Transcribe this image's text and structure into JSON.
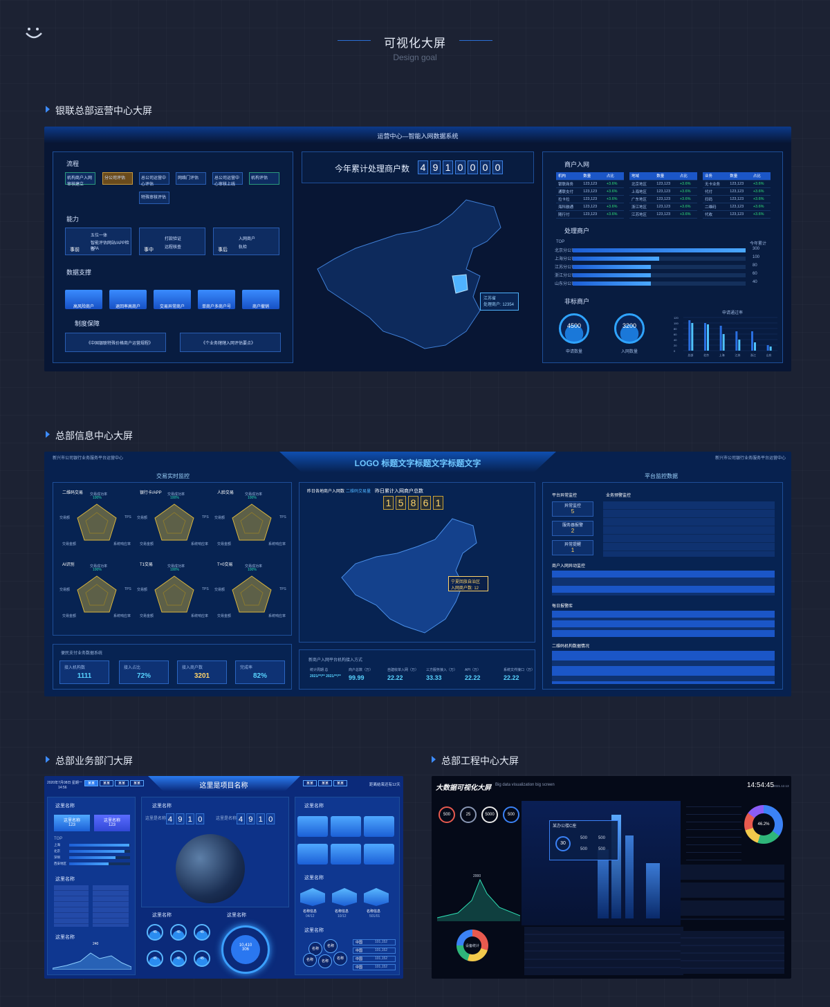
{
  "header": {
    "title": "可视化大屏",
    "subtitle": "Design goal",
    "logo_icon": "smile-icon"
  },
  "sections": [
    {
      "title": "银联总部运营中心大屏"
    },
    {
      "title": "总部信息中心大屏"
    },
    {
      "title": "总部业务部门大屏"
    },
    {
      "title": "总部工程中心大屏"
    }
  ],
  "screen1": {
    "title": "运营中心—智能入网数据系统",
    "flow": {
      "title": "流程",
      "steps": [
        "机构商户入网审核建立",
        "分公司评估",
        "总公司运营中心评估",
        "网络门评估",
        "总公司运营中心审核上线",
        "机构评估",
        "特殊审核评估"
      ]
    },
    "ability": {
      "title": "能力",
      "items": [
        {
          "tag": "事前",
          "lines": [
            "五位一体",
            "智能评估网站/APP检查",
            "RPA"
          ]
        },
        {
          "tag": "事中",
          "lines": [
            "打款验证",
            "远程核查"
          ]
        },
        {
          "tag": "事后",
          "lines": [
            "入网商户",
            "轨检"
          ]
        }
      ]
    },
    "support": {
      "title": "数据支撑",
      "items": [
        "高风险商户",
        "退回率高商户",
        "交易异常商户",
        "单商户多商户号",
        "商户撤销"
      ]
    },
    "policy": {
      "title": "制度保障",
      "items": [
        "《中国银联特殊价格商户运营规程》",
        "《个业务辖辖入网评估要点》"
      ]
    },
    "counter": {
      "label": "今年累计处理商户数",
      "digits": [
        "4",
        "9",
        "1",
        "0",
        "0",
        "0",
        "0"
      ]
    },
    "map_tip": {
      "province": "江苏省",
      "value": "处理商户: 12354"
    },
    "merchant": {
      "title": "商户入网",
      "tables": [
        {
          "head": [
            "机构",
            "数量",
            "占比"
          ],
          "rows": [
            [
              "银联商务",
              "123,123",
              "+3.6%"
            ],
            [
              "通联支付",
              "123,123",
              "+3.6%"
            ],
            [
              "拉卡拉",
              "123,123",
              "+3.6%"
            ],
            [
              "海科融通",
              "123,123",
              "+3.6%"
            ],
            [
              "随行付",
              "123,123",
              "+3.6%"
            ]
          ]
        },
        {
          "head": [
            "地域",
            "数量",
            "占比"
          ],
          "rows": [
            [
              "北京地区",
              "123,123",
              "+3.6%"
            ],
            [
              "上海地区",
              "123,123",
              "+3.6%"
            ],
            [
              "广东地区",
              "123,123",
              "+3.6%"
            ],
            [
              "浙江地区",
              "123,123",
              "+3.6%"
            ],
            [
              "江苏地区",
              "123,123",
              "+3.6%"
            ]
          ]
        },
        {
          "head": [
            "业务",
            "数量",
            "占比"
          ],
          "rows": [
            [
              "无卡业务",
              "123,123",
              "+3.6%"
            ],
            [
              "代付",
              "123,123",
              "+3.6%"
            ],
            [
              "扫码",
              "123,123",
              "+3.6%"
            ],
            [
              "二维码",
              "123,123",
              "+3.6%"
            ],
            [
              "代收",
              "123,123",
              "+3.6%"
            ]
          ]
        }
      ]
    },
    "process": {
      "title": "处理商户",
      "top_label": "TOP",
      "right_label": "今年累计",
      "rows": [
        {
          "name": "北京分公司",
          "value": 300
        },
        {
          "name": "上海分公司",
          "value": 100
        },
        {
          "name": "江苏分公司",
          "value": 80
        },
        {
          "name": "浙江分公司",
          "value": 60
        },
        {
          "name": "山东分公司",
          "value": 40
        }
      ]
    },
    "nonstd": {
      "title": "非标商户",
      "gauges": [
        {
          "value": "4500",
          "label": "申请数量"
        },
        {
          "value": "3200",
          "label": "入网数量"
        }
      ],
      "chart_title": "申请通过率"
    }
  },
  "chart_data": [
    {
      "type": "bar",
      "title": "申请通过率",
      "categories": [
        "总部",
        "北京",
        "上海",
        "江苏",
        "浙江",
        "山东"
      ],
      "series": [
        {
          "values": [
            110,
            100,
            90,
            70,
            70,
            20
          ]
        },
        {
          "values": [
            100,
            95,
            60,
            40,
            30,
            15
          ]
        }
      ],
      "ylim": [
        0,
        120
      ],
      "yticks": [
        0,
        20,
        40,
        60,
        80,
        100,
        120
      ]
    }
  ],
  "screen2": {
    "title": "LOGO 标题文字标题文字标题文字",
    "left_top_note": "新兴市公司银行业务服务平台运营中心",
    "right_top_note": "新兴市公司银行业务服务平台运营中心",
    "left_tab": "交易实时监控",
    "right_tab": "平台监控数据",
    "radar_titles": [
      "二维码交易",
      "银行卡/APP",
      "人脸交易",
      "AI识别",
      "T1交易",
      "T+0交易"
    ],
    "radar_labels": {
      "top": "交易成功率",
      "top_val": "100%",
      "left": "交易额",
      "right": "TPS",
      "bl": "交易金额",
      "br": "系统响应率",
      "val": "60%"
    },
    "map_tabs": [
      "昨日各地商户入网数",
      "二维码交易量"
    ],
    "counter_label": "昨日累计入网商户总数",
    "counter": [
      "1",
      "5",
      "8",
      "6",
      "1"
    ],
    "map_tip": {
      "title": "宁夏回族自治区",
      "value": "入网商户数: 12"
    },
    "bottom_left": {
      "title": "便民支付业务数据系统",
      "cards": [
        {
          "label": "接入机构数",
          "value": "1111"
        },
        {
          "label": "接入占比",
          "value": "72%"
        },
        {
          "label": "接入商户数",
          "value": "3201"
        },
        {
          "label": "完成率",
          "value": "82%"
        }
      ]
    },
    "bottom_mid": {
      "title": "新商户入网平台机构接入方式",
      "cols": [
        {
          "label": "统计周期 总",
          "value": "2021/**/** 2021/**/**"
        },
        {
          "label": "商户总数（万）",
          "value": "99.99"
        },
        {
          "label": "自建收单入网（万）",
          "value": "22.22"
        },
        {
          "label": "三方服务接入（万）",
          "value": "33.33"
        },
        {
          "label": "API（万）",
          "value": "22.22"
        },
        {
          "label": "系统文件接口（万）",
          "value": "22.22"
        }
      ]
    },
    "platform": {
      "title": "平台异常监控",
      "items": [
        {
          "label": "异常监控",
          "value": "5"
        },
        {
          "label": "服务器报警",
          "value": "2"
        },
        {
          "label": "异常提醒",
          "value": "1"
        }
      ]
    },
    "warn": {
      "title": "业务预警监控"
    },
    "merchant_title": "商户入网异动监控",
    "daily_title": "每日报警库",
    "qr_title": "二维码机构数据情况"
  },
  "screen3": {
    "date": "2020年7月08日 星期一",
    "time": "14:56",
    "tabs_left": [
      "某某",
      "某某",
      "某某",
      "某某"
    ],
    "tabs_right": [
      "某某",
      "某某",
      "某某"
    ],
    "title": "这里是项目名称",
    "countdown": "距离结束还有12天",
    "panel_title": "这里名称",
    "blue_cards": [
      {
        "label": "这里名称",
        "value": "123"
      },
      {
        "label": "这里名称",
        "value": "123"
      }
    ],
    "counter_label": "这里是名称",
    "counter_a": [
      "4",
      "9",
      "1",
      "0"
    ],
    "counter_b": [
      "4",
      "9",
      "1",
      "0"
    ],
    "top_label": "TOP",
    "bars": [
      "上海",
      "北京",
      "深圳",
      "西安地区"
    ],
    "gauges": [
      "45",
      "45",
      "45",
      "45",
      "45",
      "45"
    ],
    "ring_value": "10,410",
    "ring_sub": "306",
    "cubes": [
      {
        "label": "名称信息",
        "value": "04/12"
      },
      {
        "label": "名称信息",
        "value": "10/12"
      },
      {
        "label": "名称信息",
        "value": "501/01"
      }
    ],
    "bubbles": [
      "名称",
      "名称",
      "名称",
      "名称",
      "名称"
    ],
    "list": [
      {
        "k": "中国",
        "v": "101,152"
      },
      {
        "k": "中国",
        "v": "101,152"
      },
      {
        "k": "中国",
        "v": "101,152"
      },
      {
        "k": "中国",
        "v": "101,152"
      }
    ],
    "peak": "240"
  },
  "screen4": {
    "title": "大数据可视化大屏",
    "subtitle": "Big data visualization big screen",
    "time": "14:54:45",
    "date": "2021.12.13",
    "circles": [
      "500",
      "25",
      "5000",
      "500"
    ],
    "popup_title": "某办公楼C座",
    "popup_vals": [
      "500",
      "500",
      "500",
      "500"
    ],
    "popup_main": "30",
    "donut_value": "46.2%",
    "peak_val": "2000",
    "center_label": "设备统计"
  }
}
